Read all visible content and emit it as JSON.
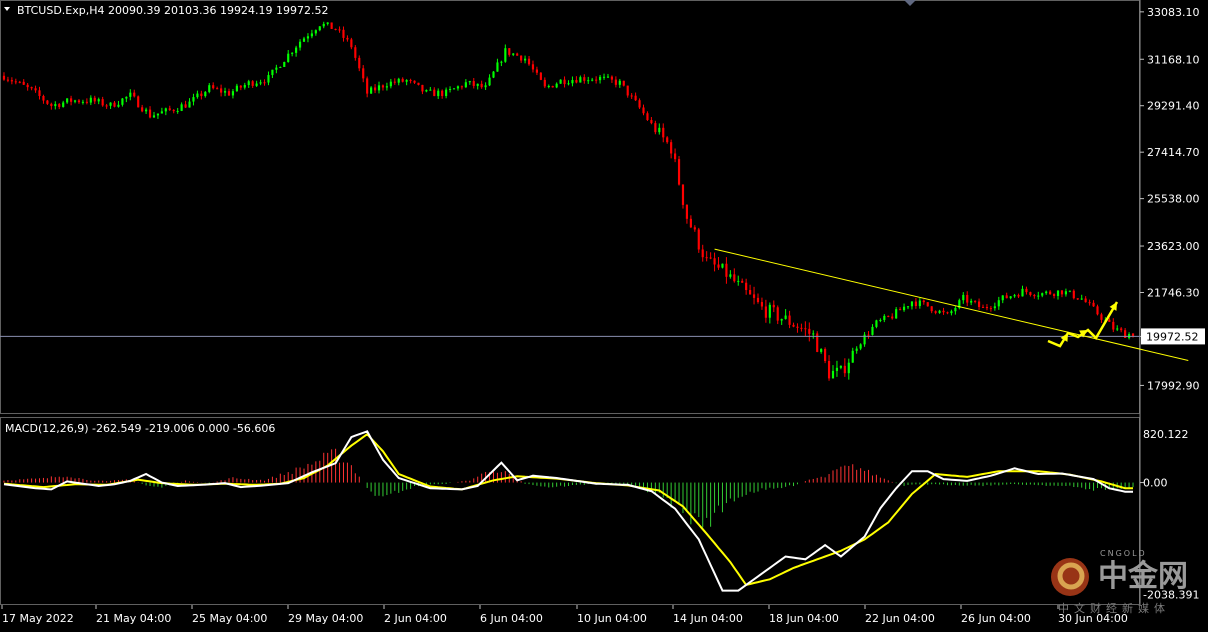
{
  "symbol_header": "BTCUSD.Exp,H4  20090.39 20103.36 19924.19 19972.52",
  "macd_header": "MACD(12,26,9) -262.549 -219.006 0.000 -56.606",
  "current_price_label": "19972.52",
  "watermark": {
    "en": "CNGOLD",
    "cn": "中金网",
    "sub": "中文财经新媒体"
  },
  "colors": {
    "background": "#000000",
    "bull_candle": "#00ff00",
    "bear_candle": "#ff0000",
    "trendline": "#ffff00",
    "macd_line": "#ffffff",
    "signal_line": "#ffff00",
    "hist_positive": "#ff3333",
    "hist_negative": "#33cc33",
    "price_line": "#8a8fb0"
  },
  "chart_data": [
    {
      "type": "candlestick",
      "title": "BTCUSD.Exp,H4",
      "open": 20090.39,
      "high": 20103.36,
      "low": 19924.19,
      "close": 19972.52,
      "ylim": [
        17000,
        33400
      ],
      "y_ticks": [
        "33083.10",
        "31168.10",
        "29291.40",
        "27414.70",
        "25538.00",
        "23623.00",
        "21746.30",
        "19972.52",
        "17992.90"
      ],
      "x_ticks": [
        "17 May 2022",
        "21 May 04:00",
        "25 May 04:00",
        "29 May 04:00",
        "2 Jun 04:00",
        "6 Jun 04:00",
        "10 Jun 04:00",
        "14 Jun 04:00",
        "18 Jun 04:00",
        "22 Jun 04:00",
        "26 Jun 04:00",
        "30 Jun 04:00"
      ],
      "trend_path": [
        [
          0,
          30500
        ],
        [
          7,
          29900
        ],
        [
          12,
          29300
        ],
        [
          17,
          29500
        ],
        [
          22,
          29500
        ],
        [
          27,
          29300
        ],
        [
          32,
          29700
        ],
        [
          37,
          28900
        ],
        [
          42,
          29100
        ],
        [
          47,
          29400
        ],
        [
          52,
          30000
        ],
        [
          57,
          29800
        ],
        [
          62,
          30200
        ],
        [
          67,
          30400
        ],
        [
          70,
          31000
        ],
        [
          75,
          31900
        ],
        [
          80,
          32600
        ],
        [
          84,
          32400
        ],
        [
          88,
          31700
        ],
        [
          92,
          29800
        ],
        [
          97,
          30200
        ],
        [
          102,
          30300
        ],
        [
          107,
          29800
        ],
        [
          112,
          29800
        ],
        [
          117,
          30200
        ],
        [
          122,
          30000
        ],
        [
          127,
          31500
        ],
        [
          132,
          31200
        ],
        [
          137,
          30000
        ],
        [
          141,
          30300
        ],
        [
          146,
          30400
        ],
        [
          151,
          30400
        ],
        [
          156,
          30200
        ],
        [
          161,
          29200
        ],
        [
          165,
          28300
        ],
        [
          169,
          27600
        ],
        [
          173,
          24800
        ],
        [
          178,
          23000
        ],
        [
          183,
          22500
        ],
        [
          188,
          21700
        ],
        [
          192,
          21100
        ],
        [
          196,
          20800
        ],
        [
          201,
          20400
        ],
        [
          205,
          20000
        ],
        [
          209,
          18500
        ],
        [
          212,
          18500
        ],
        [
          216,
          19600
        ],
        [
          221,
          20500
        ],
        [
          225,
          20800
        ],
        [
          230,
          21400
        ],
        [
          234,
          21200
        ],
        [
          239,
          20800
        ],
        [
          243,
          21500
        ],
        [
          248,
          21100
        ],
        [
          253,
          21500
        ],
        [
          258,
          21800
        ],
        [
          263,
          21700
        ],
        [
          268,
          21800
        ],
        [
          273,
          21500
        ],
        [
          277,
          20900
        ],
        [
          281,
          20300
        ],
        [
          284,
          20060
        ]
      ],
      "trendline": [
        [
          180,
          23500
        ],
        [
          300,
          19000
        ]
      ],
      "price_line": 19972.52
    },
    {
      "type": "macd",
      "title": "MACD(12,26,9)",
      "macd": -262.549,
      "signal": -219.006,
      "histogram": -56.606,
      "ylim": [
        -2100,
        1100
      ],
      "y_ticks": [
        "820.122",
        "0.00",
        "-2038.391"
      ],
      "macd_path": [
        [
          0,
          -30
        ],
        [
          8,
          -100
        ],
        [
          12,
          -120
        ],
        [
          16,
          20
        ],
        [
          20,
          -20
        ],
        [
          24,
          -60
        ],
        [
          28,
          -30
        ],
        [
          32,
          30
        ],
        [
          36,
          150
        ],
        [
          40,
          0
        ],
        [
          44,
          -60
        ],
        [
          50,
          -40
        ],
        [
          56,
          -10
        ],
        [
          60,
          -80
        ],
        [
          66,
          -50
        ],
        [
          72,
          -10
        ],
        [
          78,
          180
        ],
        [
          84,
          340
        ],
        [
          88,
          800
        ],
        [
          92,
          900
        ],
        [
          96,
          400
        ],
        [
          100,
          80
        ],
        [
          108,
          -100
        ],
        [
          116,
          -120
        ],
        [
          120,
          -60
        ],
        [
          126,
          350
        ],
        [
          130,
          40
        ],
        [
          134,
          120
        ],
        [
          140,
          80
        ],
        [
          150,
          -20
        ],
        [
          158,
          -40
        ],
        [
          164,
          -150
        ],
        [
          170,
          -460
        ],
        [
          176,
          -1000
        ],
        [
          182,
          -1900
        ],
        [
          186,
          -1900
        ],
        [
          192,
          -1600
        ],
        [
          198,
          -1300
        ],
        [
          203,
          -1350
        ],
        [
          208,
          -1100
        ],
        [
          212,
          -1300
        ],
        [
          218,
          -950
        ],
        [
          222,
          -450
        ],
        [
          226,
          -100
        ],
        [
          230,
          200
        ],
        [
          234,
          200
        ],
        [
          238,
          60
        ],
        [
          244,
          30
        ],
        [
          250,
          120
        ],
        [
          256,
          250
        ],
        [
          262,
          150
        ],
        [
          268,
          160
        ],
        [
          276,
          60
        ],
        [
          280,
          -100
        ],
        [
          284,
          -160
        ]
      ],
      "signal_path": [
        [
          0,
          -20
        ],
        [
          10,
          -80
        ],
        [
          18,
          -30
        ],
        [
          26,
          -40
        ],
        [
          34,
          50
        ],
        [
          40,
          -10
        ],
        [
          48,
          -40
        ],
        [
          56,
          -20
        ],
        [
          64,
          -40
        ],
        [
          70,
          -20
        ],
        [
          76,
          80
        ],
        [
          82,
          300
        ],
        [
          88,
          650
        ],
        [
          92,
          850
        ],
        [
          96,
          550
        ],
        [
          100,
          150
        ],
        [
          108,
          -70
        ],
        [
          116,
          -120
        ],
        [
          124,
          40
        ],
        [
          130,
          110
        ],
        [
          140,
          70
        ],
        [
          150,
          -10
        ],
        [
          158,
          -50
        ],
        [
          166,
          -140
        ],
        [
          172,
          -420
        ],
        [
          178,
          -900
        ],
        [
          184,
          -1400
        ],
        [
          188,
          -1800
        ],
        [
          194,
          -1700
        ],
        [
          200,
          -1500
        ],
        [
          206,
          -1350
        ],
        [
          212,
          -1200
        ],
        [
          218,
          -1000
        ],
        [
          224,
          -700
        ],
        [
          230,
          -200
        ],
        [
          236,
          150
        ],
        [
          244,
          100
        ],
        [
          252,
          200
        ],
        [
          262,
          200
        ],
        [
          270,
          140
        ],
        [
          278,
          20
        ],
        [
          284,
          -100
        ]
      ],
      "hist_path": [
        [
          0,
          40
        ],
        [
          10,
          70
        ],
        [
          16,
          130
        ],
        [
          20,
          60
        ],
        [
          26,
          20
        ],
        [
          32,
          60
        ],
        [
          36,
          -50
        ],
        [
          40,
          -80
        ],
        [
          46,
          30
        ],
        [
          52,
          -10
        ],
        [
          58,
          80
        ],
        [
          66,
          40
        ],
        [
          74,
          220
        ],
        [
          80,
          400
        ],
        [
          84,
          500
        ],
        [
          88,
          300
        ],
        [
          92,
          -100
        ],
        [
          96,
          -300
        ],
        [
          100,
          -150
        ],
        [
          106,
          -40
        ],
        [
          112,
          -20
        ],
        [
          118,
          40
        ],
        [
          124,
          240
        ],
        [
          128,
          140
        ],
        [
          132,
          -20
        ],
        [
          138,
          -80
        ],
        [
          148,
          -30
        ],
        [
          156,
          -40
        ],
        [
          164,
          -150
        ],
        [
          170,
          -400
        ],
        [
          176,
          -700
        ],
        [
          180,
          -600
        ],
        [
          184,
          -300
        ],
        [
          190,
          -150
        ],
        [
          196,
          -100
        ],
        [
          200,
          -50
        ],
        [
          204,
          50
        ],
        [
          208,
          100
        ],
        [
          212,
          250
        ],
        [
          216,
          280
        ],
        [
          220,
          150
        ],
        [
          224,
          40
        ],
        [
          228,
          -60
        ],
        [
          232,
          -30
        ],
        [
          240,
          -40
        ],
        [
          248,
          -50
        ],
        [
          256,
          -30
        ],
        [
          262,
          -40
        ],
        [
          270,
          -70
        ],
        [
          276,
          -120
        ],
        [
          284,
          -100
        ]
      ]
    }
  ]
}
